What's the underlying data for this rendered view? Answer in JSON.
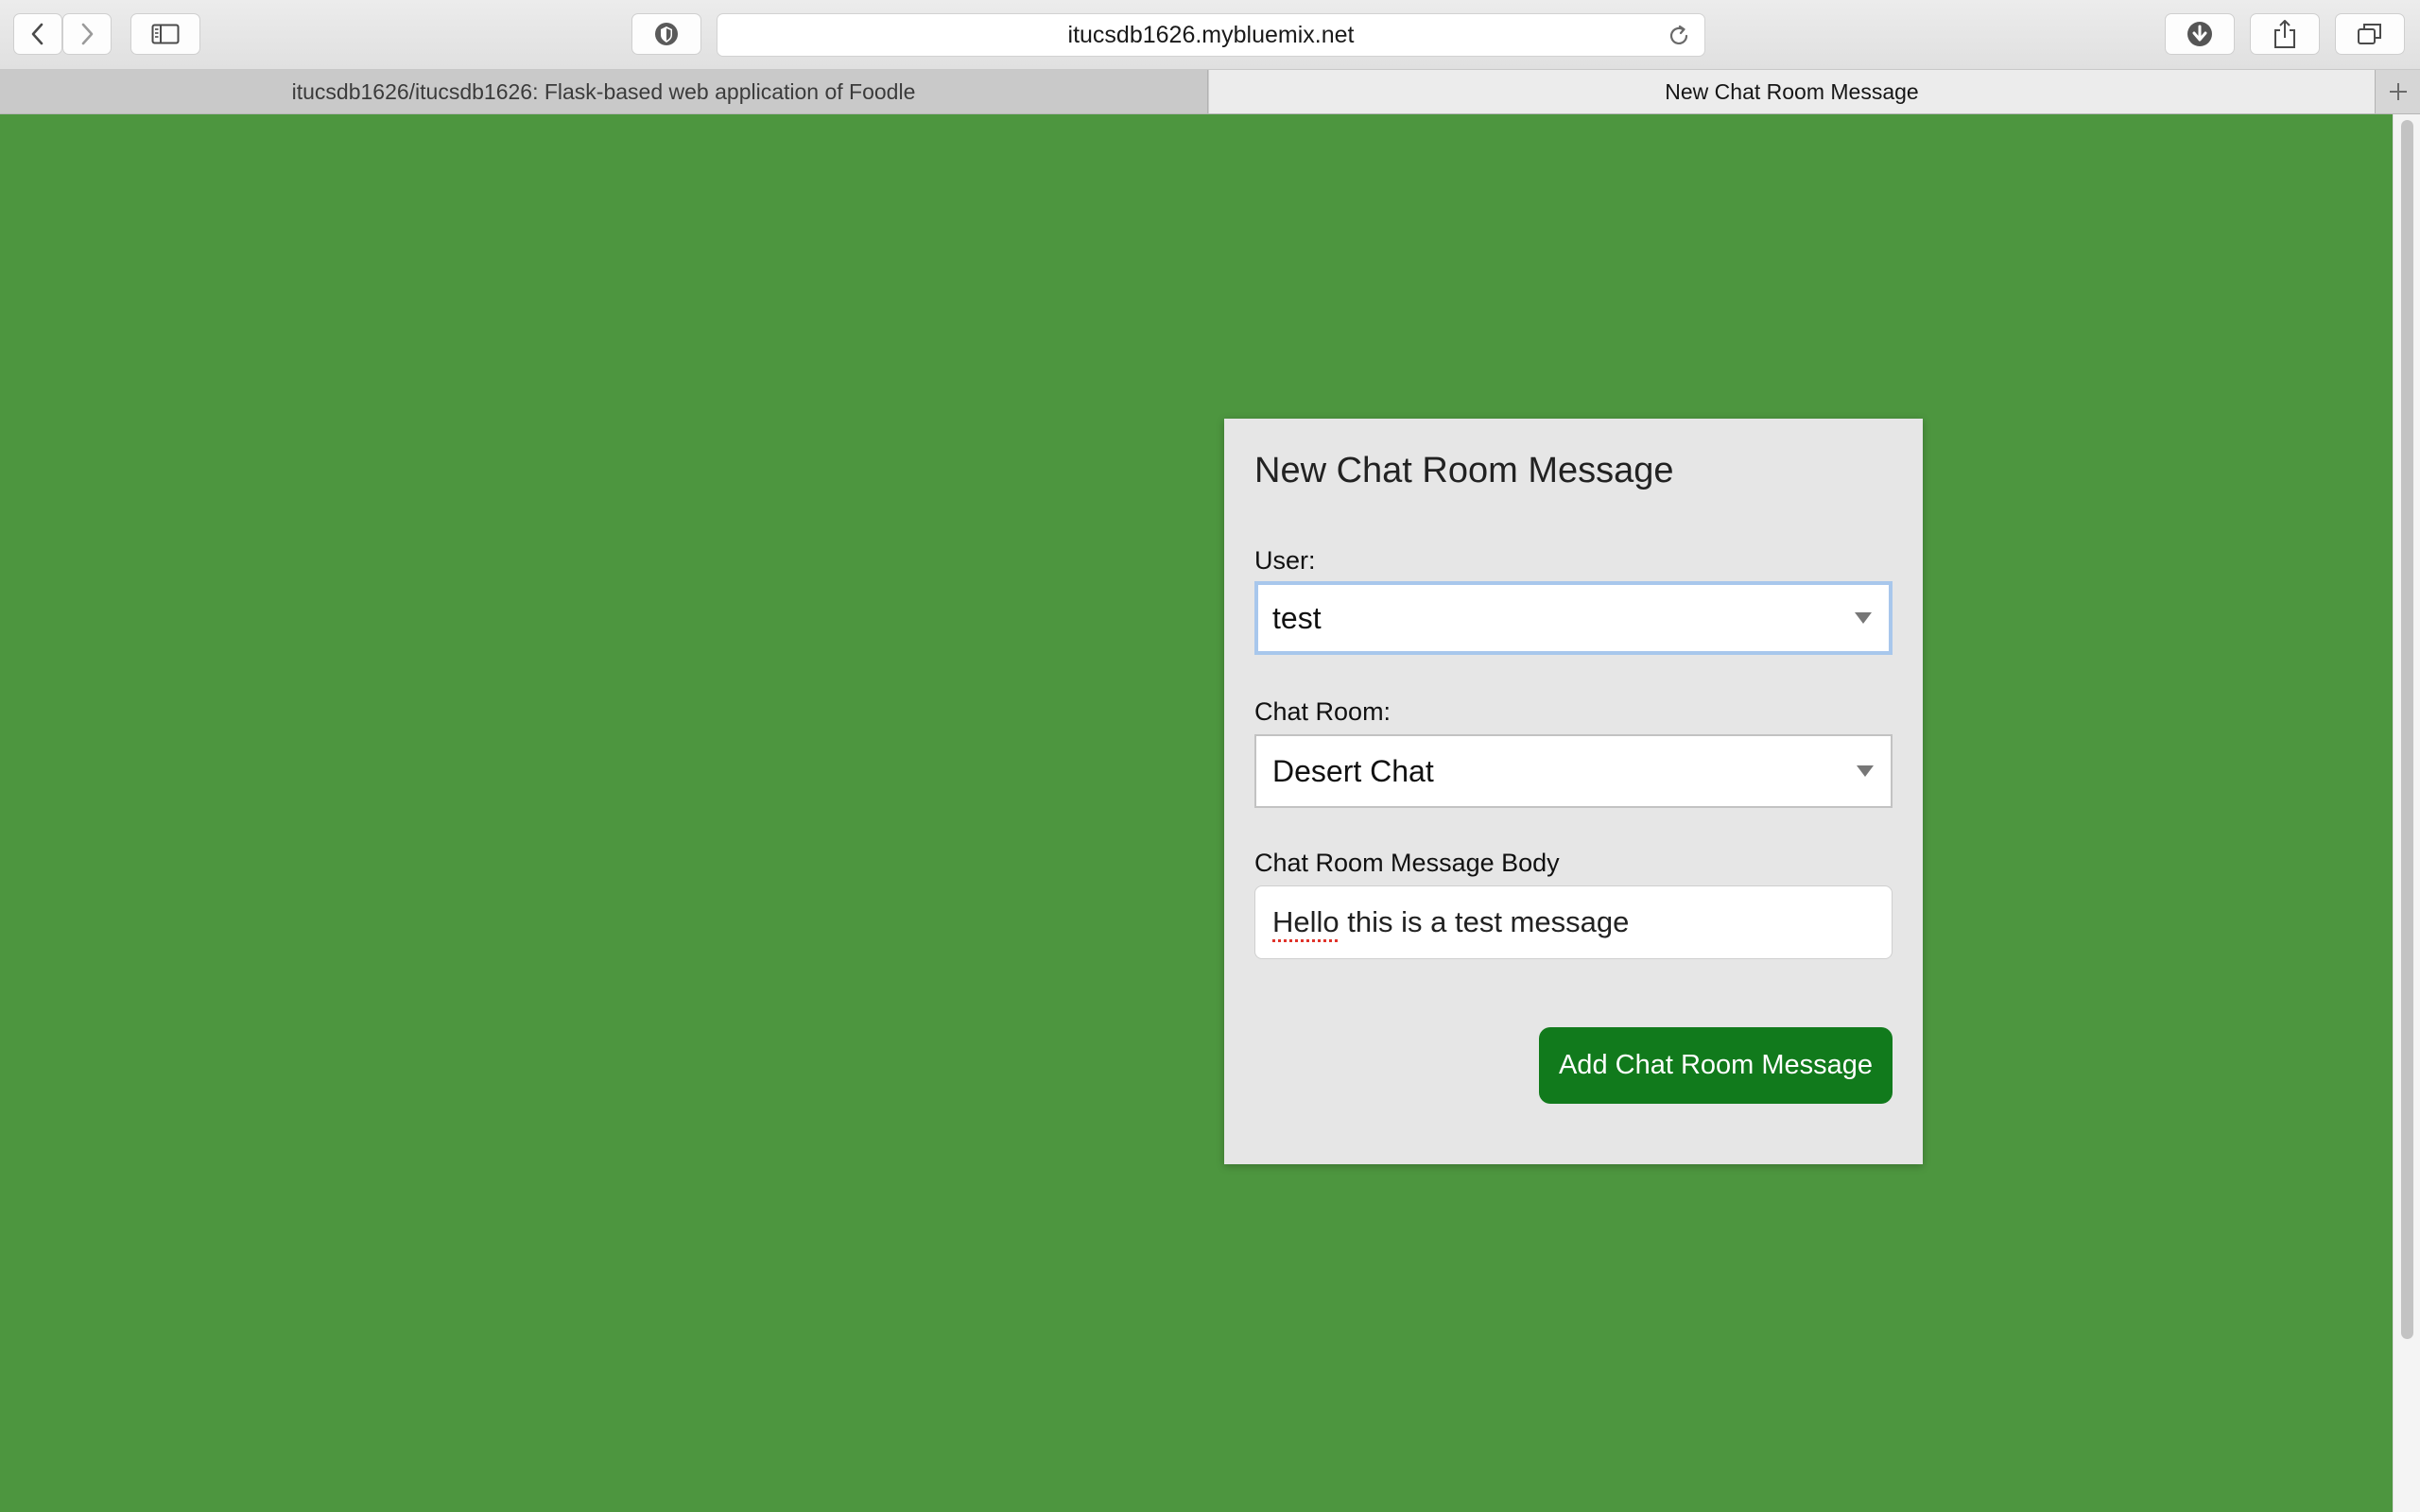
{
  "browser": {
    "url": "itucsdb1626.mybluemix.net",
    "tabs": [
      {
        "label": "itucsdb1626/itucsdb1626: Flask-based web application of Foodle",
        "active": false
      },
      {
        "label": "New Chat Room Message",
        "active": true
      }
    ],
    "icons": {
      "back": "chevron-left-icon",
      "forward": "chevron-right-icon",
      "sidebar": "sidebar-icon",
      "shield": "shield-icon",
      "reload": "reload-icon",
      "download": "download-icon",
      "share": "share-icon",
      "tabs": "tabs-overview-icon",
      "new_tab": "plus-icon"
    }
  },
  "form": {
    "title": "New Chat Room Message",
    "user_label": "User:",
    "user_value": "test",
    "chat_room_label": "Chat Room:",
    "chat_room_value": "Desert Chat",
    "body_label": "Chat Room Message Body",
    "body_value_misspelled": "Hello",
    "body_value_rest": " this is a test message",
    "submit_label": "Add Chat Room Message"
  },
  "colors": {
    "page_background": "#4d963f",
    "card_background": "#e6e6e6",
    "submit_button": "#117a1c",
    "focus_ring": "#a8c7ec"
  }
}
